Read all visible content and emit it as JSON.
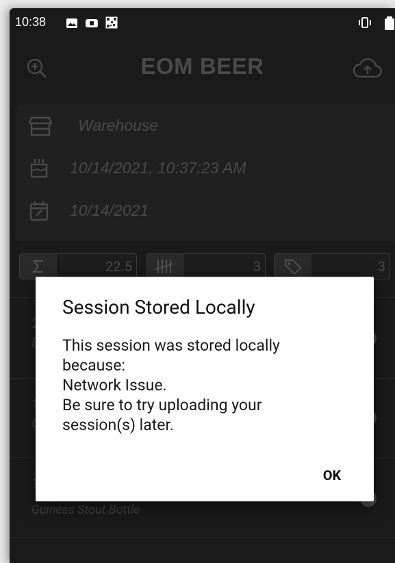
{
  "status_bar": {
    "time": "10:38"
  },
  "app_bar": {
    "title": "EOM BEER",
    "zoom_icon": "zoom-in-icon",
    "upload_icon": "cloud-upload-icon"
  },
  "session_info": {
    "location": "Warehouse",
    "created": "10/14/2021, 10:37:23 AM",
    "date": "10/14/2021"
  },
  "stats": [
    {
      "icon": "sigma-icon",
      "value": "22.5"
    },
    {
      "icon": "tally-icon",
      "value": "3"
    },
    {
      "icon": "tag-icon",
      "value": "3"
    }
  ],
  "list": {
    "items": [
      {
        "title": "2",
        "subtitle": "E"
      },
      {
        "title": "1",
        "subtitle": "C"
      },
      {
        "title": "1",
        "subtitle": "Guiness Stout Bottle"
      }
    ]
  },
  "dialog": {
    "title": "Session Stored Locally",
    "body_lines": [
      "This session was stored locally",
      "because:",
      "Network Issue.",
      "Be sure to try uploading your",
      "session(s) later."
    ],
    "ok_label": "OK"
  },
  "colors": {
    "background": "#1a1a1a",
    "dialog": "#ffffff",
    "muted": "#4a4a4a"
  }
}
